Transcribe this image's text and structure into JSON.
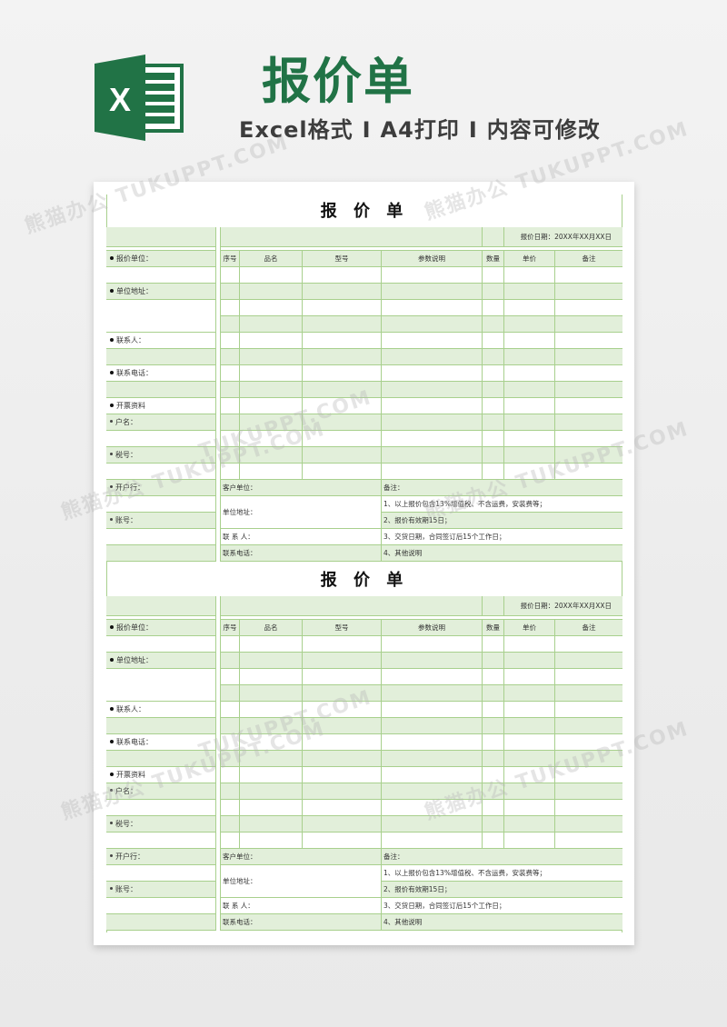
{
  "banner": {
    "logo_icon": "excel-icon",
    "title": "报价单",
    "subtitle_parts": [
      "Excel格式",
      "A4打印",
      "内容可修改"
    ],
    "separator": "I",
    "brand_color": "#217346",
    "watermarks": [
      "熊猫办公 TUKUPPT.COM",
      "熊猫办公 TUKUPPT.COM",
      "熊猫办公 TUKUPPT.COM",
      "熊猫办公 TUKUPPT.COM",
      "TUKUPPT.COM",
      "熊猫办公 TUKUPPT.COM",
      "TUKUPPT.COM",
      "熊猫办公 TUKUPPT.COM"
    ]
  },
  "colors": {
    "grid_line": "#a8d08d",
    "row_fill": "#e2efda",
    "page": "#ffffff"
  },
  "forms": [
    {
      "title": "报 价 单",
      "date_label": "报价日期：20XX年XX月XX日",
      "left_labels": {
        "quote_unit": "报价单位：",
        "unit_address": "单位地址：",
        "contact": "联系人：",
        "phone": "联系电话：",
        "invoice_info": "开票资料",
        "account_name": "户名：",
        "tax_no": "税号：",
        "bank": "开户行：",
        "account_no": "账号："
      },
      "table_headers": [
        "序号",
        "品名",
        "型号",
        "参数说明",
        "数量",
        "单价",
        "备注"
      ],
      "row_count": 13,
      "customer": {
        "unit": "客户单位：",
        "address": "单位地址：",
        "contact": "联 系 人：",
        "phone": "联系电话："
      },
      "notes": {
        "label": "备注：",
        "items": [
          "1、以上报价包含13%增值税、不含运费，安装费等；",
          "2、报价有效期15日；",
          "3、交货日期，合同签订后15个工作日；",
          "4、其他说明"
        ]
      }
    },
    {
      "title": "报 价 单",
      "date_label": "报价日期：20XX年XX月XX日",
      "left_labels": {
        "quote_unit": "报价单位：",
        "unit_address": "单位地址：",
        "contact": "联系人：",
        "phone": "联系电话：",
        "invoice_info": "开票资料",
        "account_name": "户名：",
        "tax_no": "税号：",
        "bank": "开户行：",
        "account_no": "账号："
      },
      "table_headers": [
        "序号",
        "品名",
        "型号",
        "参数说明",
        "数量",
        "单价",
        "备注"
      ],
      "row_count": 13,
      "customer": {
        "unit": "客户单位：",
        "address": "单位地址：",
        "contact": "联 系 人：",
        "phone": "联系电话："
      },
      "notes": {
        "label": "备注：",
        "items": [
          "1、以上报价包含13%增值税、不含运费，安装费等；",
          "2、报价有效期15日；",
          "3、交货日期，合同签订后15个工作日；",
          "4、其他说明"
        ]
      }
    }
  ]
}
